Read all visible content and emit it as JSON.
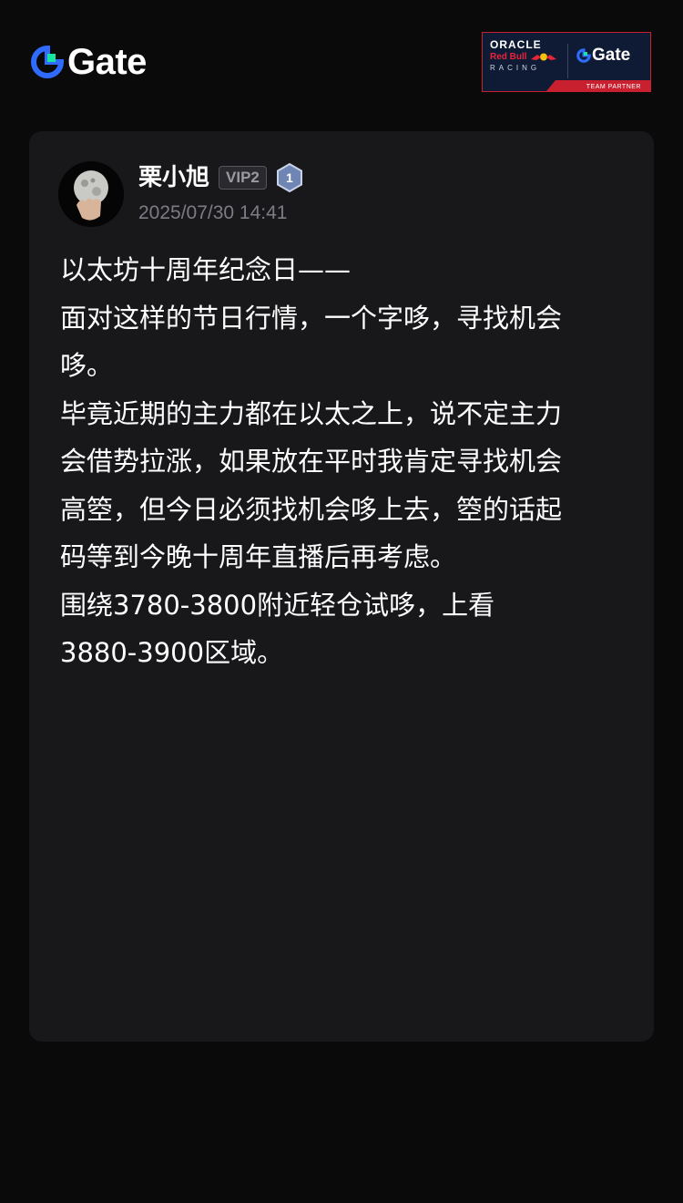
{
  "header": {
    "brand_name": "Gate",
    "brand_color": "#2f6bff",
    "partner_banner": {
      "oracle": "ORACLE",
      "redbull": "Red Bull",
      "racing": "RACING",
      "gate": "Gate",
      "team_partner": "TEAM PARTNER"
    }
  },
  "post": {
    "author": "栗小旭",
    "vip": "VIP2",
    "level": "1",
    "timestamp": "2025/07/30 14:41",
    "avatar_icon": "moon-in-hand-avatar",
    "lines": [
      "以太坊十周年纪念日——",
      "面对这样的节日行情，一个字哆，寻找机会",
      "哆。",
      "毕竟近期的主力都在以太之上，说不定主力",
      "会借势拉涨，如果放在平时我肯定寻找机会",
      "高箜，但今日必须找机会哆上去，箜的话起",
      "码等到今晚十周年直播后再考虑。",
      "围绕3780-3800附近轻仓试哆，上看",
      "3880-3900区域。"
    ]
  }
}
